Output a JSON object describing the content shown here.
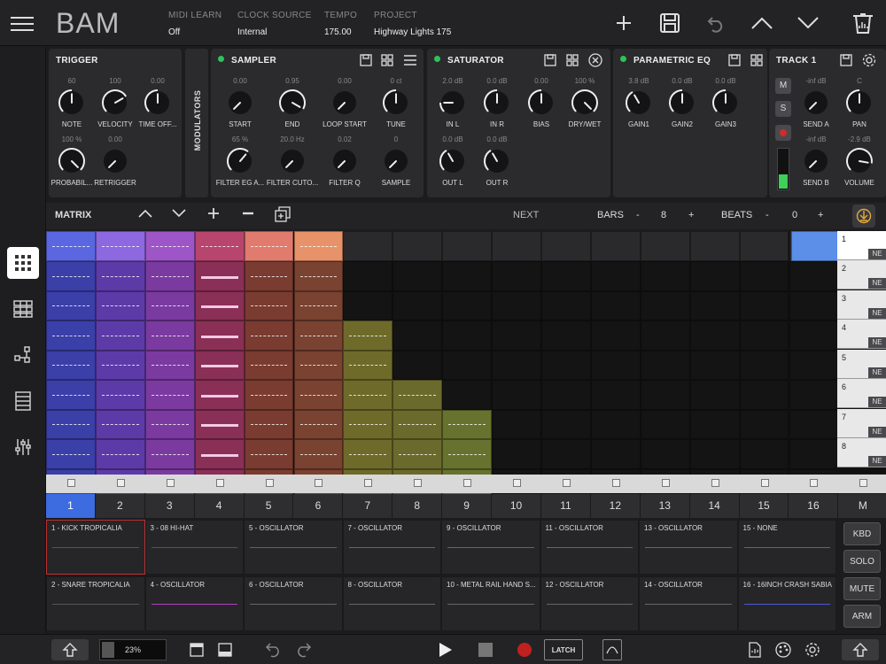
{
  "app": {
    "title": "BAM"
  },
  "header": {
    "midi_learn": {
      "label": "MIDI LEARN",
      "value": "Off"
    },
    "clock_source": {
      "label": "CLOCK SOURCE",
      "value": "Internal"
    },
    "tempo": {
      "label": "TEMPO",
      "value": "175.00"
    },
    "project": {
      "label": "PROJECT",
      "value": "Highway Lights 175"
    }
  },
  "trigger": {
    "title": "TRIGGER",
    "knobs": [
      {
        "value": "60",
        "label": "NOTE"
      },
      {
        "value": "100",
        "label": "VELOCITY"
      },
      {
        "value": "0.00",
        "label": "TIME OFF..."
      },
      {
        "value": "100 %",
        "label": "PROBABIL..."
      },
      {
        "value": "0.00",
        "label": "RETRIGGER"
      }
    ]
  },
  "modulators": {
    "label": "MODULATORS"
  },
  "sampler": {
    "title": "SAMPLER",
    "knobs": [
      {
        "value": "0.00",
        "label": "START"
      },
      {
        "value": "0.95",
        "label": "END"
      },
      {
        "value": "0.00",
        "label": "LOOP START"
      },
      {
        "value": "0 ct",
        "label": "TUNE"
      },
      {
        "value": "65 %",
        "label": "FILTER EG A..."
      },
      {
        "value": "20.0 Hz",
        "label": "FILTER CUTO..."
      },
      {
        "value": "0.02",
        "label": "FILTER Q"
      },
      {
        "value": "0",
        "label": "SAMPLE"
      }
    ]
  },
  "saturator": {
    "title": "SATURATOR",
    "knobs": [
      {
        "value": "2.0 dB",
        "label": "IN L"
      },
      {
        "value": "0.0 dB",
        "label": "IN R"
      },
      {
        "value": "0.00",
        "label": "BIAS"
      },
      {
        "value": "100 %",
        "label": "DRY/WET"
      },
      {
        "value": "0.0 dB",
        "label": "OUT L"
      },
      {
        "value": "0.0 dB",
        "label": "OUT R"
      }
    ]
  },
  "eq": {
    "title": "PARAMETRIC EQ",
    "knobs": [
      {
        "value": "3.8 dB",
        "label": "GAIN1"
      },
      {
        "value": "0.0 dB",
        "label": "GAIN2"
      },
      {
        "value": "0.0 dB",
        "label": "GAIN3"
      }
    ]
  },
  "track1": {
    "title": "TRACK 1",
    "m": "M",
    "s": "S",
    "knobs": [
      {
        "value": "-inf dB",
        "label": "SEND A"
      },
      {
        "value": "C",
        "label": "PAN"
      },
      {
        "value": "-inf dB",
        "label": "SEND B"
      },
      {
        "value": "-2.9 dB",
        "label": "VOLUME"
      }
    ]
  },
  "matrix": {
    "title": "MATRIX",
    "next": "NEXT",
    "bars_label": "BARS",
    "bars_value": "8",
    "beats_label": "BEATS",
    "beats_value": "0",
    "minus": "-",
    "plus": "+"
  },
  "scenes": [
    {
      "n": "1",
      "ne": "NE"
    },
    {
      "n": "2",
      "ne": "NE"
    },
    {
      "n": "3",
      "ne": "NE"
    },
    {
      "n": "4",
      "ne": "NE"
    },
    {
      "n": "5",
      "ne": "NE"
    },
    {
      "n": "6",
      "ne": "NE"
    },
    {
      "n": "7",
      "ne": "NE"
    },
    {
      "n": "8",
      "ne": "NE"
    }
  ],
  "columns": [
    "1",
    "2",
    "3",
    "4",
    "5",
    "6",
    "7",
    "8",
    "9",
    "10",
    "11",
    "12",
    "13",
    "14",
    "15",
    "16",
    "M"
  ],
  "tracks": [
    "1 - KICK TROPICALIA",
    "3 - 08 HI-HAT",
    "5 - OSCILLATOR",
    "7 - OSCILLATOR",
    "9 - OSCILLATOR",
    "11 - OSCILLATOR",
    "13 - OSCILLATOR",
    "15 - NONE",
    "2 - SNARE TROPICALIA",
    "4 - OSCILLATOR",
    "6 - OSCILLATOR",
    "8 - OSCILLATOR",
    "10 - METAL RAIL HAND S...",
    "12 - OSCILLATOR",
    "14 - OSCILLATOR",
    "16 - 16INCH CRASH SABIA..."
  ],
  "right_buttons": {
    "kbd": "KBD",
    "solo": "SOLO",
    "mute": "MUTE",
    "arm": "ARM"
  },
  "bottom": {
    "zoom": "23%",
    "latch": "LATCH"
  },
  "colors": {
    "accent": "#3d6be0",
    "led": "#2fc25a",
    "record": "#d22a2a"
  }
}
